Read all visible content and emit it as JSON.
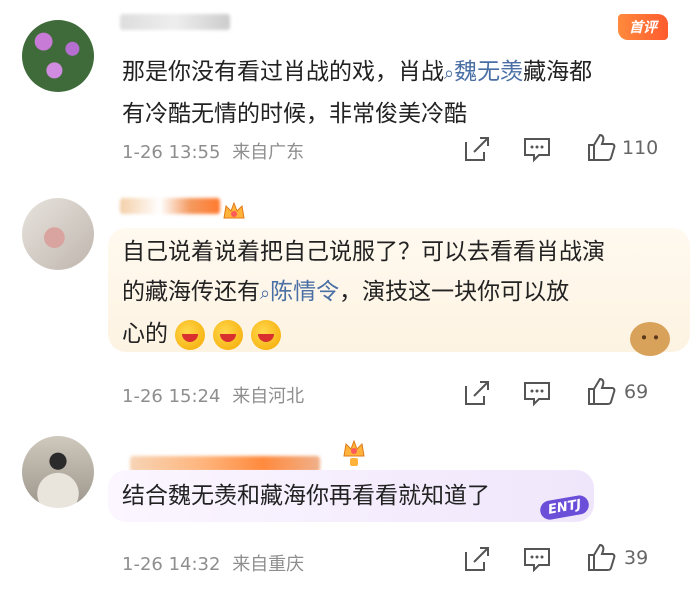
{
  "comments": [
    {
      "badge": "首评",
      "text_line1_a": "那是你没有看过肖战的戏，肖战",
      "text_line1_topic": "魏无羡",
      "text_line1_b": "藏海都",
      "text_line2": "有冷酷无情的时候，非常俊美冷酷",
      "timestamp": "1-26 13:55",
      "location": "来自广东",
      "likes": "110"
    },
    {
      "text_line1": "自己说着说着把自己说服了？可以去看看肖战演",
      "text_line2_a": "的藏海传还有",
      "text_line2_topic": "陈情令",
      "text_line2_b": "，演技这一块你可以放",
      "text_line3": "心的",
      "timestamp": "1-26 15:24",
      "location": "来自河北",
      "likes": "69"
    },
    {
      "text_line1": "结合魏无羡和藏海你再看看就知道了",
      "timestamp": "1-26 14:32",
      "location": "来自重庆",
      "likes": "39",
      "sticker_text": "ENTJ"
    }
  ],
  "icons": [
    "repost-icon",
    "comment-icon",
    "like-icon",
    "search-topic-icon",
    "crown-icon"
  ],
  "colors": {
    "topic": "#4a6fa5",
    "meta": "#8e8e8e",
    "badge": "#ff6a2e"
  }
}
